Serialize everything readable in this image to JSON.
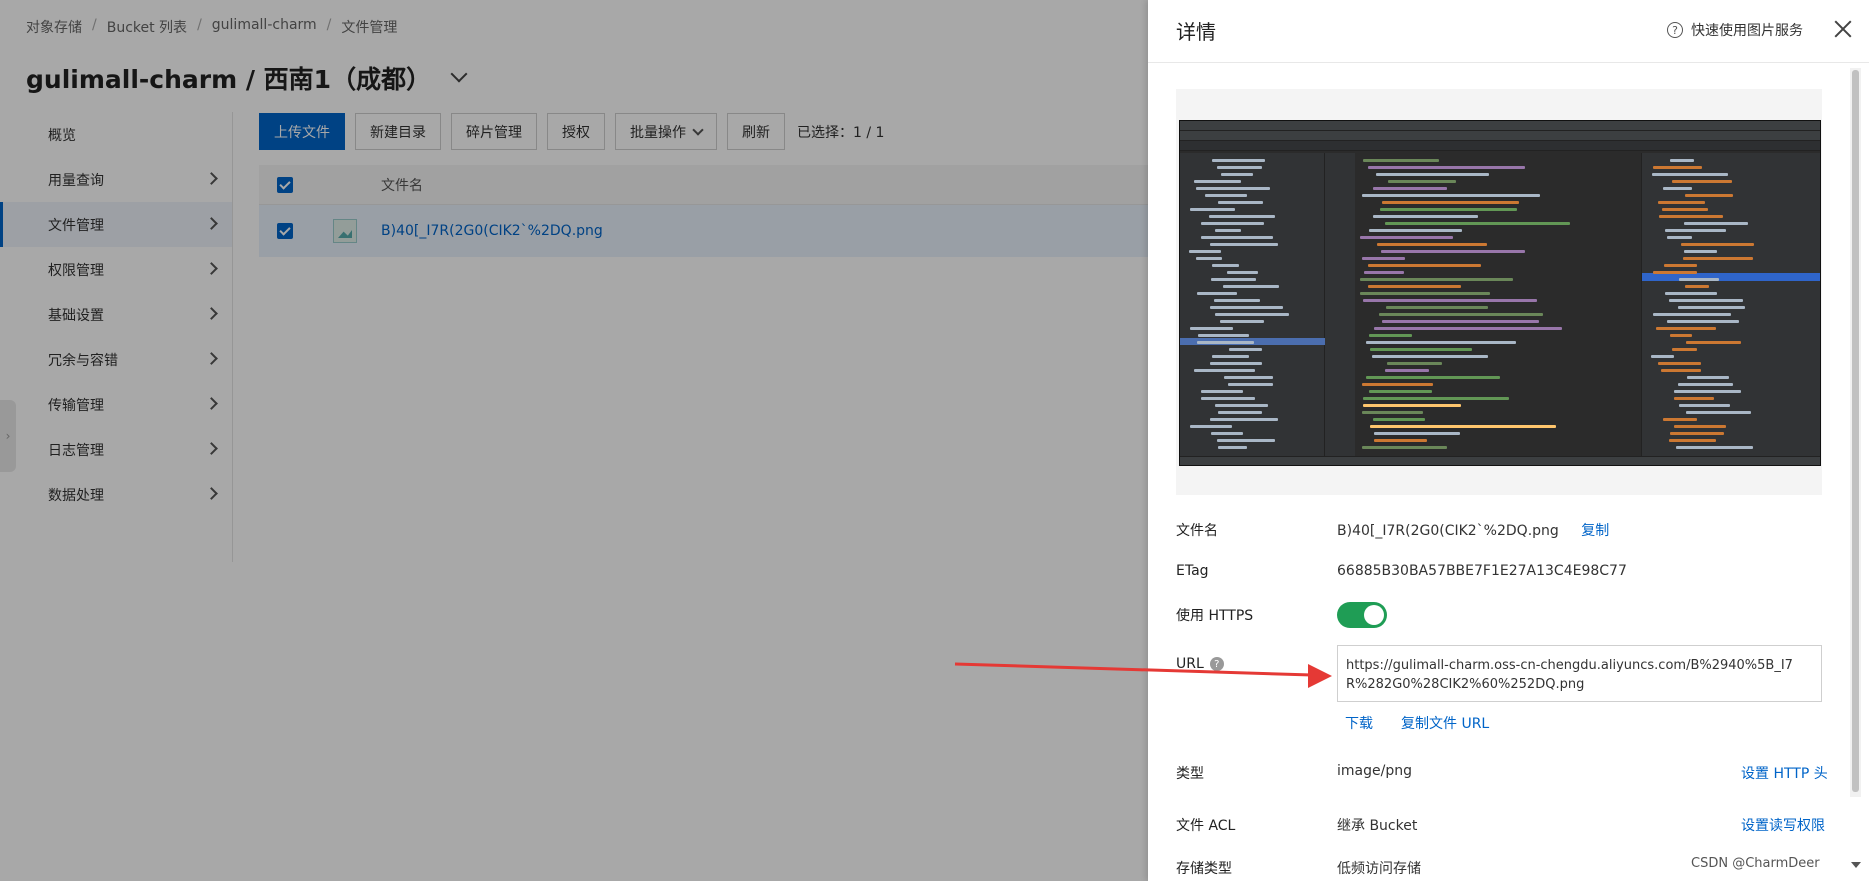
{
  "breadcrumb": [
    "对象存储",
    "Bucket 列表",
    "gulimall-charm",
    "文件管理"
  ],
  "page_title": "gulimall-charm / 西南1（成都）",
  "sidebar": {
    "items": [
      {
        "label": "概览"
      },
      {
        "label": "用量查询"
      },
      {
        "label": "文件管理",
        "active": true
      },
      {
        "label": "权限管理"
      },
      {
        "label": "基础设置"
      },
      {
        "label": "冗余与容错"
      },
      {
        "label": "传输管理"
      },
      {
        "label": "日志管理"
      },
      {
        "label": "数据处理"
      }
    ]
  },
  "toolbar": {
    "upload": "上传文件",
    "new_dir": "新建目录",
    "fragments": "碎片管理",
    "authorize": "授权",
    "batch": "批量操作",
    "refresh": "刷新",
    "selected": "已选择：1 / 1"
  },
  "table": {
    "header_name": "文件名",
    "rows": [
      {
        "name": "B)40[_I7R(2G0(CIK2`%2DQ.png"
      }
    ]
  },
  "drawer": {
    "title": "详情",
    "help_link": "快速使用图片服务",
    "labels": {
      "file_name": "文件名",
      "etag": "ETag",
      "https": "使用 HTTPS",
      "url": "URL",
      "type": "类型",
      "acl": "文件 ACL",
      "storage": "存储类型"
    },
    "values": {
      "file_name": "B)40[_I7R(2G0(CIK2`%2DQ.png",
      "etag": "66885B30BA57BBE7F1E27A13C4E98C77",
      "https_enabled": true,
      "url": "https://gulimall-charm.oss-cn-chengdu.aliyuncs.com/B%2940%5B_I7R%282G0%28CIK2%60%252DQ.png",
      "type": "image/png",
      "acl": "继承 Bucket",
      "storage": "低频访问存储"
    },
    "links": {
      "copy": "复制",
      "download": "下载",
      "copy_url": "复制文件 URL",
      "set_http_header": "设置 HTTP 头",
      "set_acl": "设置读写权限"
    }
  },
  "watermark": "CSDN @CharmDeer",
  "colors": {
    "primary": "#0064c8",
    "toggle_on": "#1f9d55",
    "arrow": "#e53935"
  }
}
